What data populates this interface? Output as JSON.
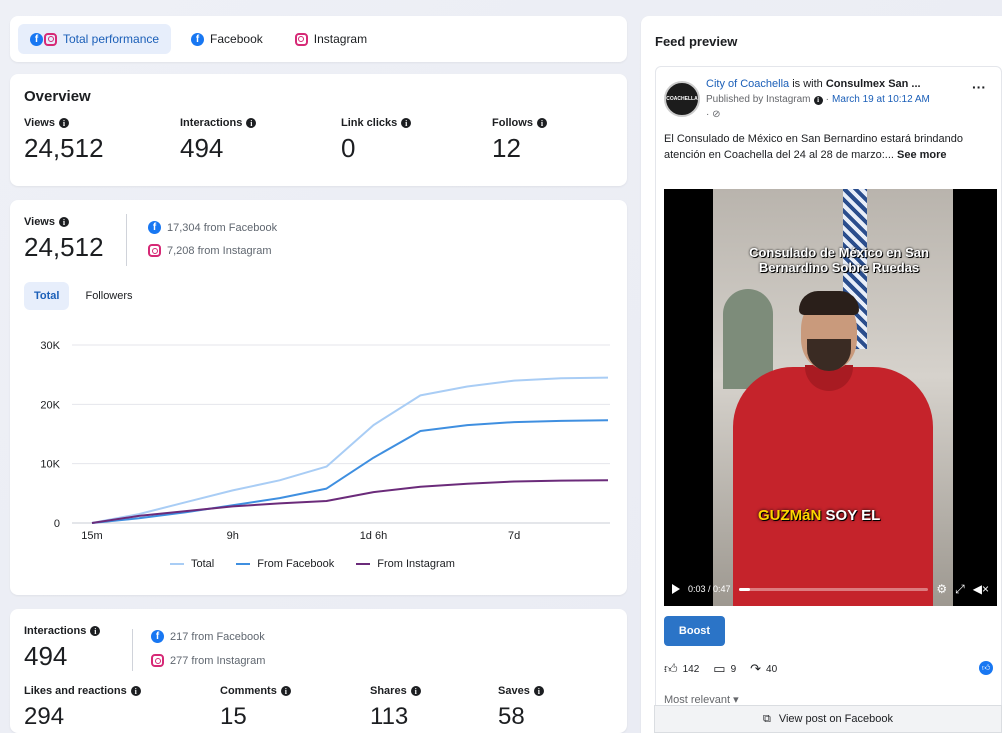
{
  "tabs": [
    {
      "label": "Total performance",
      "icon": "facebook-instagram-icon"
    },
    {
      "label": "Facebook",
      "icon": "facebook-icon"
    },
    {
      "label": "Instagram",
      "icon": "instagram-icon"
    }
  ],
  "overview": {
    "title": "Overview",
    "metrics": [
      {
        "label": "Views",
        "value": "24,512"
      },
      {
        "label": "Interactions",
        "value": "494"
      },
      {
        "label": "Link clicks",
        "value": "0"
      },
      {
        "label": "Follows",
        "value": "12"
      }
    ]
  },
  "views": {
    "label": "Views",
    "value": "24,512",
    "from_facebook": "17,304 from Facebook",
    "from_instagram": "7,208 from Instagram",
    "subtabs": [
      "Total",
      "Followers"
    ]
  },
  "chart_data": {
    "type": "line",
    "x": [
      "15m",
      "",
      "",
      "9h",
      "",
      "",
      "1d 6h",
      "",
      "",
      "7d",
      "",
      ""
    ],
    "x_ticks": [
      "15m",
      "9h",
      "1d 6h",
      "7d"
    ],
    "y_ticks": [
      "0",
      "10K",
      "20K",
      "30K"
    ],
    "ylim": [
      0,
      30000
    ],
    "series": [
      {
        "name": "Total",
        "color": "#a9cdf5",
        "values": [
          0,
          1500,
          3500,
          5500,
          7200,
          9500,
          16500,
          21500,
          23000,
          24000,
          24400,
          24512
        ]
      },
      {
        "name": "From Facebook",
        "color": "#3f8fe0",
        "values": [
          0,
          800,
          1800,
          3000,
          4200,
          5800,
          11000,
          15500,
          16500,
          17000,
          17200,
          17304
        ]
      },
      {
        "name": "From Instagram",
        "color": "#6b2b7a",
        "values": [
          0,
          1200,
          2000,
          2800,
          3300,
          3700,
          5200,
          6100,
          6600,
          7000,
          7150,
          7208
        ]
      }
    ],
    "grid": true,
    "legend": "bottom"
  },
  "interactions": {
    "label": "Interactions",
    "value": "494",
    "from_facebook": "217 from Facebook",
    "from_instagram": "277 from Instagram",
    "breakdown": [
      {
        "label": "Likes and reactions",
        "value": "294"
      },
      {
        "label": "Comments",
        "value": "15"
      },
      {
        "label": "Shares",
        "value": "113"
      },
      {
        "label": "Saves",
        "value": "58"
      }
    ]
  },
  "feed": {
    "title": "Feed preview",
    "page_name": "City of Coachella",
    "with_text": " is with ",
    "with_name": "Consulmex San ...",
    "published_by": "Published by Instagram",
    "date": "March 19 at 10:12 AM",
    "avatar_text": "COACHELLA",
    "caption": "El Consulado de México en San Bernardino estará brindando atención en Coachella del 24 al 28 de marzo:...",
    "see_more": "See more",
    "video_title": "Consulado de México en San Bernardino Sobre Ruedas",
    "video_caption_a": "GUZMáN",
    "video_caption_b": "SOY EL",
    "time": "0:03 / 0:47",
    "progress": 0.06,
    "boost": "Boost",
    "likes": "142",
    "comments": "9",
    "shares": "40",
    "most_relevant": "Most relevant",
    "view_post": "View post on Facebook"
  }
}
